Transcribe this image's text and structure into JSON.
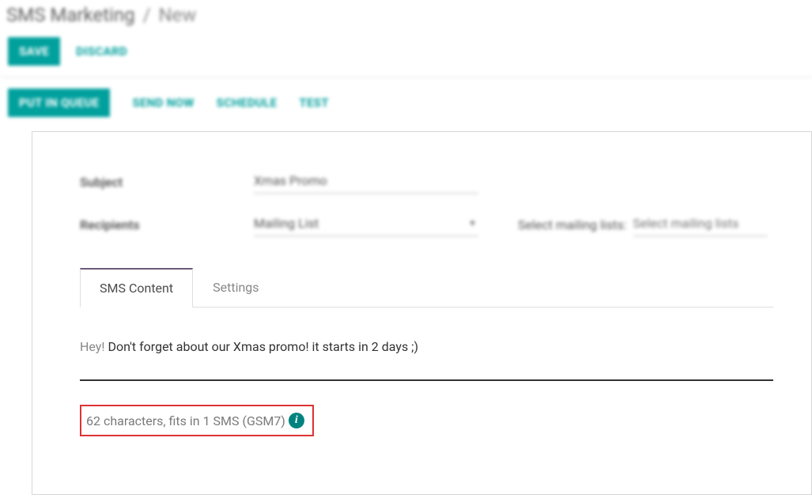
{
  "breadcrumb": {
    "root": "SMS Marketing",
    "sep": "/",
    "current": "New"
  },
  "buttons": {
    "save": "Save",
    "discard": "Discard",
    "putInQueue": "Put in Queue",
    "sendNow": "Send Now",
    "schedule": "Schedule",
    "test": "Test"
  },
  "fields": {
    "subjectLabel": "Subject",
    "subjectValue": "Xmas Promo",
    "recipientsLabel": "Recipients",
    "recipientsValue": "Mailing List",
    "selectMailingListsLabel": "Select mailing lists:",
    "selectMailingListsPlaceholder": "Select mailing lists"
  },
  "tabs": {
    "smsContent": "SMS Content",
    "settings": "Settings"
  },
  "sms": {
    "hey": "Hey!",
    "body": " Don't forget about our Xmas promo! it starts in 2 days ;)"
  },
  "charCount": "62 characters, fits in 1 SMS (GSM7)",
  "icons": {
    "info": "i"
  }
}
